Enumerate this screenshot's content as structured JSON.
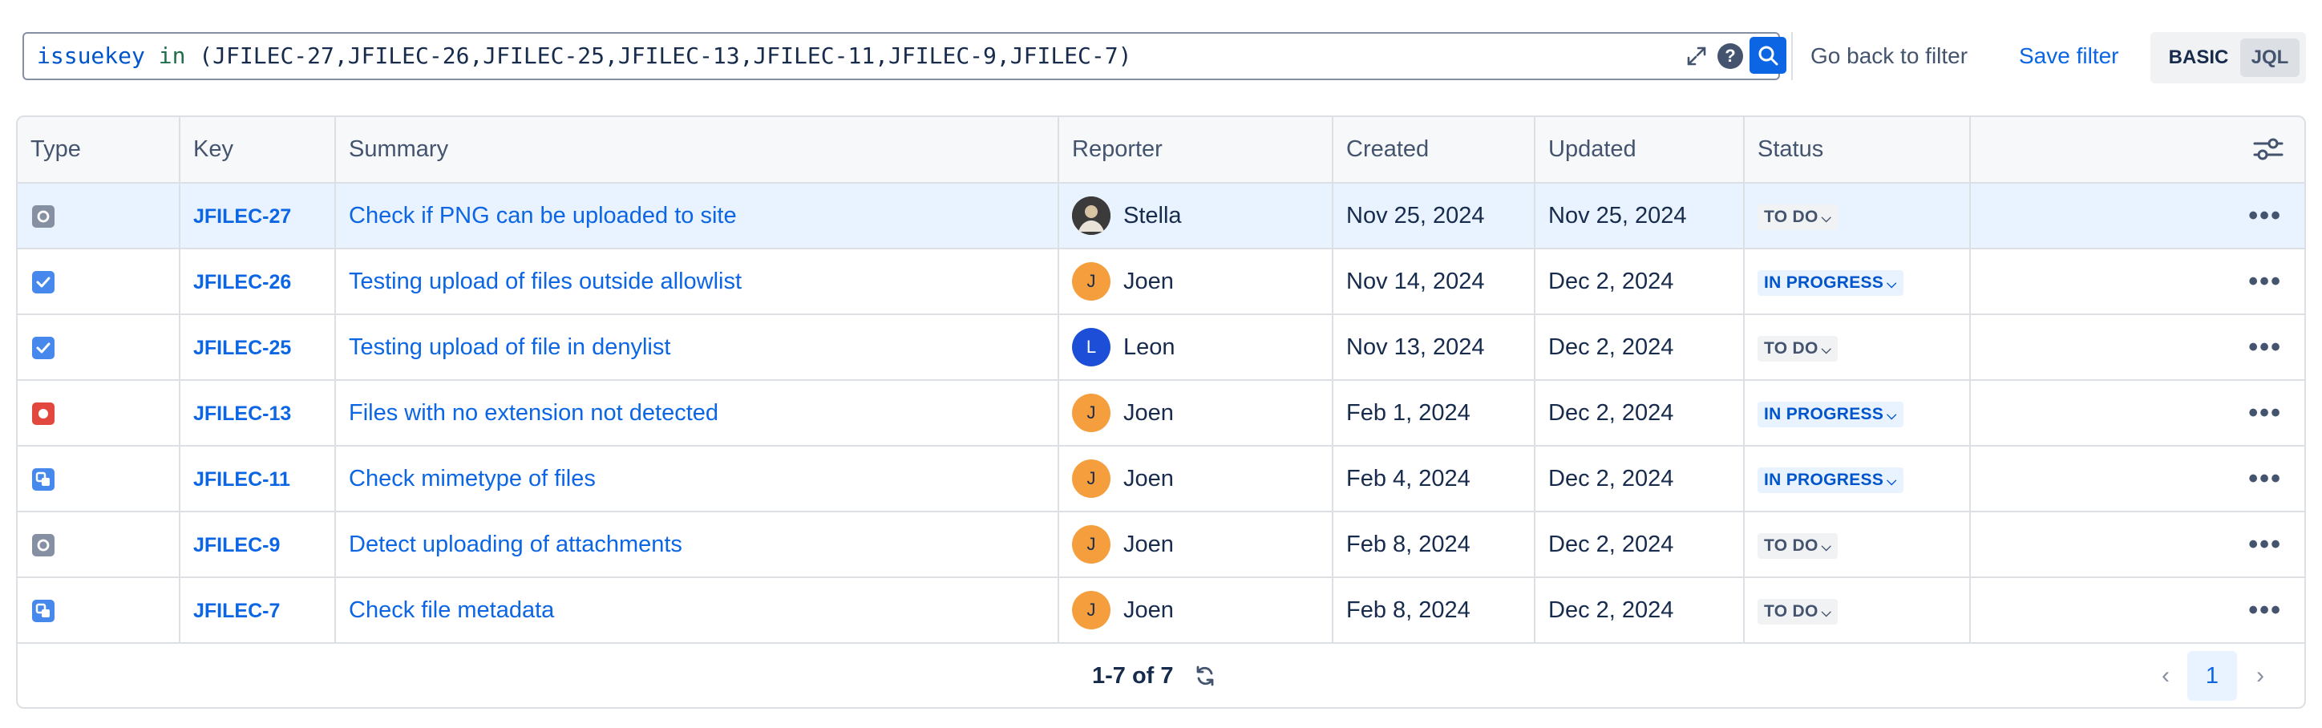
{
  "search": {
    "keyword": "issuekey",
    "operator": "in",
    "value": "(JFILEC-27,JFILEC-26,JFILEC-25,JFILEC-13,JFILEC-11,JFILEC-9,JFILEC-7)",
    "help_label": "?"
  },
  "actions": {
    "go_back": "Go back to filter",
    "save_filter": "Save filter",
    "mode_basic": "BASIC",
    "mode_jql": "JQL"
  },
  "table": {
    "columns": [
      "Type",
      "Key",
      "Summary",
      "Reporter",
      "Created",
      "Updated",
      "Status"
    ],
    "rows": [
      {
        "type": "task-gray",
        "key": "JFILEC-27",
        "summary": "Check if PNG can be uploaded to site",
        "reporter": "Stella",
        "avatar_initial": "",
        "avatar_color": "#5e4b3c",
        "created": "Nov 25, 2024",
        "updated": "Nov 25, 2024",
        "status": "TO DO",
        "status_kind": "todo"
      },
      {
        "type": "task-blue",
        "key": "JFILEC-26",
        "summary": "Testing upload of files outside allowlist",
        "reporter": "Joen",
        "avatar_initial": "J",
        "avatar_color": "#f59e3d",
        "created": "Nov 14, 2024",
        "updated": "Dec 2, 2024",
        "status": "IN PROGRESS",
        "status_kind": "progress"
      },
      {
        "type": "task-blue",
        "key": "JFILEC-25",
        "summary": "Testing upload of file in denylist",
        "reporter": "Leon",
        "avatar_initial": "L",
        "avatar_color": "#1d4ed8",
        "created": "Nov 13, 2024",
        "updated": "Dec 2, 2024",
        "status": "TO DO",
        "status_kind": "todo"
      },
      {
        "type": "bug",
        "key": "JFILEC-13",
        "summary": "Files with no extension not detected",
        "reporter": "Joen",
        "avatar_initial": "J",
        "avatar_color": "#f59e3d",
        "created": "Feb 1, 2024",
        "updated": "Dec 2, 2024",
        "status": "IN PROGRESS",
        "status_kind": "progress"
      },
      {
        "type": "subtask",
        "key": "JFILEC-11",
        "summary": "Check mimetype of files",
        "reporter": "Joen",
        "avatar_initial": "J",
        "avatar_color": "#f59e3d",
        "created": "Feb 4, 2024",
        "updated": "Dec 2, 2024",
        "status": "IN PROGRESS",
        "status_kind": "progress"
      },
      {
        "type": "task-gray",
        "key": "JFILEC-9",
        "summary": "Detect uploading of attachments",
        "reporter": "Joen",
        "avatar_initial": "J",
        "avatar_color": "#f59e3d",
        "created": "Feb 8, 2024",
        "updated": "Dec 2, 2024",
        "status": "TO DO",
        "status_kind": "todo"
      },
      {
        "type": "subtask",
        "key": "JFILEC-7",
        "summary": "Check file metadata",
        "reporter": "Joen",
        "avatar_initial": "J",
        "avatar_color": "#f59e3d",
        "created": "Feb 8, 2024",
        "updated": "Dec 2, 2024",
        "status": "TO DO",
        "status_kind": "todo"
      }
    ],
    "more_label": "•••"
  },
  "footer": {
    "count": "1-7 of 7",
    "current_page": "1",
    "prev": "‹",
    "next": "›"
  },
  "colors": {
    "accent": "#0c66e4",
    "todo_bg": "#f1f2f4",
    "todo_fg": "#44546f",
    "progress_bg": "#e9f2ff",
    "progress_fg": "#0055cc",
    "selected_row": "#e9f2ff"
  }
}
